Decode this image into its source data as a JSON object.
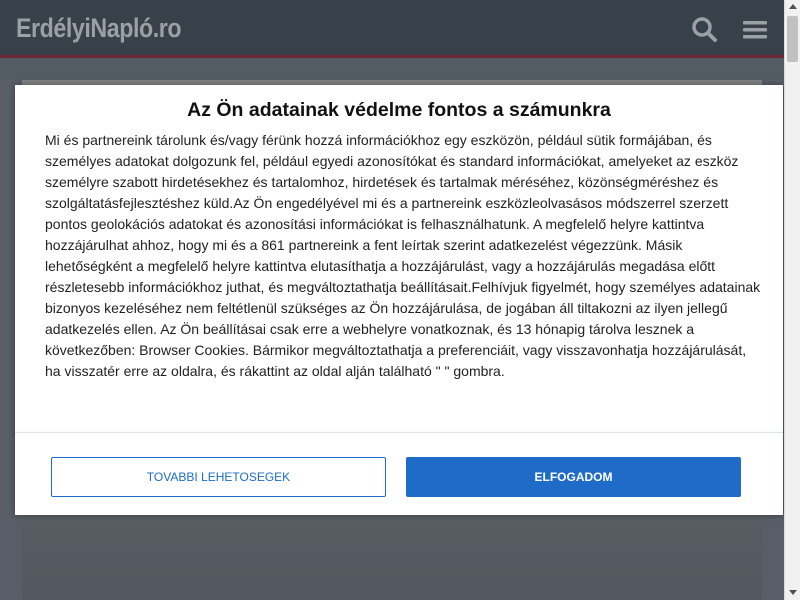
{
  "header": {
    "logo_text": "ErdélyiNapló.ro",
    "search_icon": "search-icon",
    "menu_icon": "hamburger-menu-icon"
  },
  "consent": {
    "title": "Az Ön adatainak védelme fontos a számunkra",
    "body": "Mi és partnereink tárolunk és/vagy férünk hozzá információkhoz egy eszközön, például sütik formájában, és személyes adatokat dolgozunk fel, például egyedi azonosítókat és standard információkat, amelyeket az eszköz személyre szabott hirdetésekhez és tartalomhoz, hirdetések és tartalmak méréséhez, közönségméréshez és szolgáltatásfejlesztéshez küld.Az Ön engedélyével mi és a partnereink eszközleolvasásos módszerrel szerzett pontos geolokációs adatokat és azonosítási információkat is felhasználhatunk. A megfelelő helyre kattintva hozzájárulhat ahhoz, hogy mi és a 861 partnereink a fent leírtak szerint adatkezelést végezzünk. Másik lehetőségként a megfelelő helyre kattintva elutasíthatja a hozzájárulást, vagy a hozzájárulás megadása előtt részletesebb információkhoz juthat, és megváltoztathatja beállításait.Felhívjuk figyelmét, hogy személyes adatainak bizonyos kezeléséhez nem feltétlenül szükséges az Ön hozzájárulása, de jogában áll tiltakozni az ilyen jellegű adatkezelés ellen. Az Ön beállításai csak erre a webhelyre vonatkoznak, és 13 hónapig tárolva lesznek a következőben: Browser Cookies. Bármikor megváltoztathatja a preferenciáit, vagy visszavonhatja hozzájárulását, ha visszatér erre az oldalra, és rákattint az oldal alján található \" \" gombra.",
    "more_button": "TOVABBI LEHETOSEGEK",
    "accept_button": "ELFOGADOM"
  },
  "colors": {
    "header_bg": "#3d4650",
    "header_accent": "#7a2b3a",
    "primary_blue": "#1e6cc8"
  }
}
